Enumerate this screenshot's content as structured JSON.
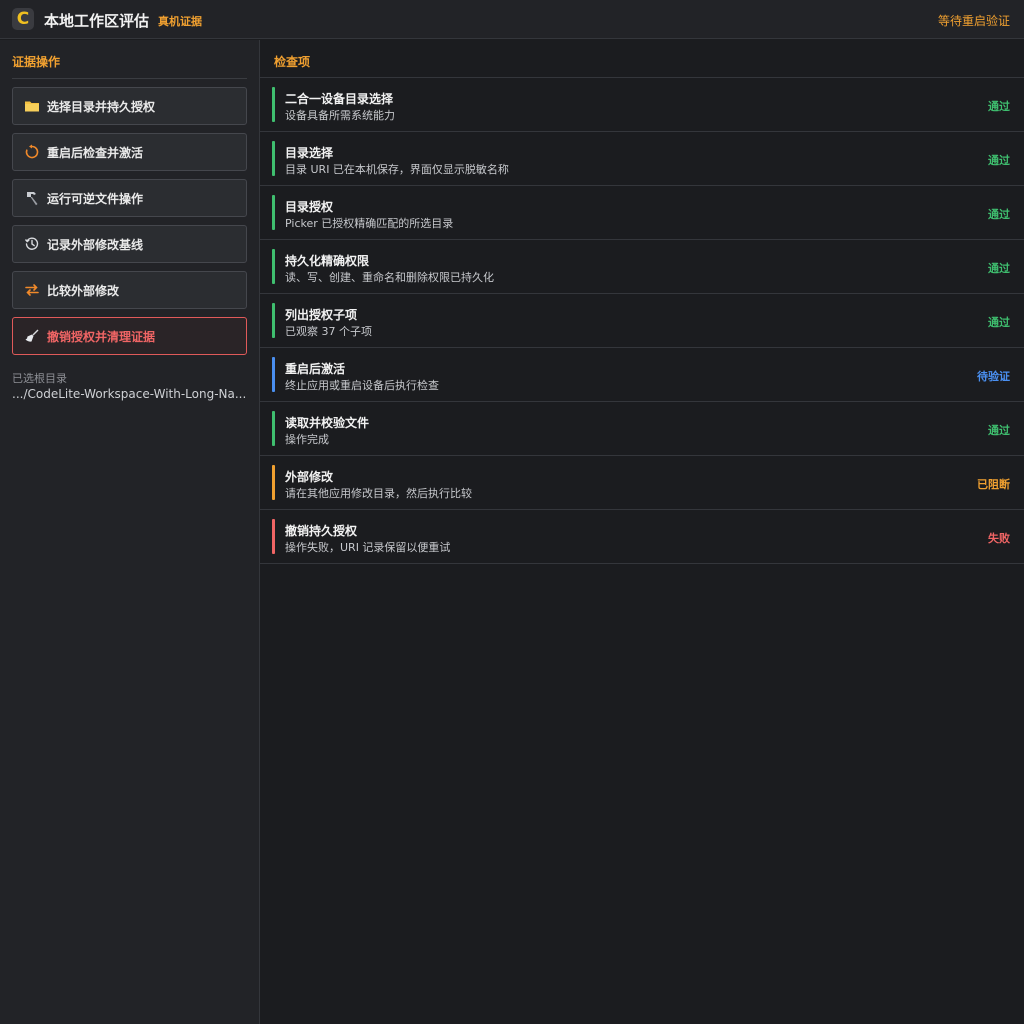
{
  "header": {
    "logo_letter": "C",
    "title": "本地工作区评估",
    "badge": "真机证据",
    "status": "等待重启验证"
  },
  "sidebar": {
    "section_title": "证据操作",
    "actions": [
      {
        "label": "选择目录并持久授权",
        "icon": "folder-icon",
        "kind": "normal"
      },
      {
        "label": "重启后检查并激活",
        "icon": "restart-icon",
        "kind": "normal"
      },
      {
        "label": "运行可逆文件操作",
        "icon": "hammer-icon",
        "kind": "normal"
      },
      {
        "label": "记录外部修改基线",
        "icon": "history-icon",
        "kind": "normal"
      },
      {
        "label": "比较外部修改",
        "icon": "compare-arrows-icon",
        "kind": "normal"
      },
      {
        "label": "撤销授权并清理证据",
        "icon": "broom-icon",
        "kind": "danger"
      }
    ],
    "root_label": "已选根目录",
    "root_path": ".../CodeLite-Workspace-With-Long-Na..."
  },
  "main": {
    "title": "检查项",
    "checks": [
      {
        "name": "二合一设备目录选择",
        "desc": "设备具备所需系统能力",
        "status": "通过",
        "state": "pass"
      },
      {
        "name": "目录选择",
        "desc": "目录 URI 已在本机保存，界面仅显示脱敏名称",
        "status": "通过",
        "state": "pass"
      },
      {
        "name": "目录授权",
        "desc": "Picker 已授权精确匹配的所选目录",
        "status": "通过",
        "state": "pass"
      },
      {
        "name": "持久化精确权限",
        "desc": "读、写、创建、重命名和删除权限已持久化",
        "status": "通过",
        "state": "pass"
      },
      {
        "name": "列出授权子项",
        "desc": "已观察 37 个子项",
        "status": "通过",
        "state": "pass"
      },
      {
        "name": "重启后激活",
        "desc": "终止应用或重启设备后执行检查",
        "status": "待验证",
        "state": "pend"
      },
      {
        "name": "读取并校验文件",
        "desc": "操作完成",
        "status": "通过",
        "state": "pass"
      },
      {
        "name": "外部修改",
        "desc": "请在其他应用修改目录，然后执行比较",
        "status": "已阻断",
        "state": "block"
      },
      {
        "name": "撤销持久授权",
        "desc": "操作失败，URI 记录保留以便重试",
        "status": "失败",
        "state": "fail"
      }
    ]
  },
  "colors": {
    "accent": "#f0a030",
    "pass": "#3fbf6f",
    "pending": "#4a8ff0",
    "blocked": "#f0a030",
    "fail": "#f06565"
  }
}
